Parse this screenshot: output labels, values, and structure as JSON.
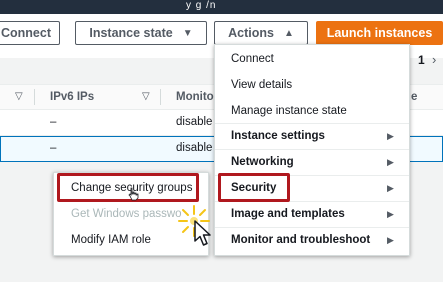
{
  "topbar": {
    "fragment": "y  g /n"
  },
  "toolbar": {
    "connect_label": "Connect",
    "instance_state_label": "Instance state",
    "actions_label": "Actions",
    "launch_label": "Launch instances",
    "caret_down": "▼",
    "caret_up": "▲"
  },
  "pager": {
    "page": "1",
    "next": "›"
  },
  "table": {
    "columns": [
      "IPv6 IPs",
      "Monito",
      "e"
    ],
    "rows": [
      {
        "ipv6": "–",
        "monitoring": "disable"
      },
      {
        "ipv6": "–",
        "monitoring": "disable"
      }
    ]
  },
  "context_menu": {
    "items": [
      {
        "label": "Change security groups",
        "disabled": false
      },
      {
        "label": "Get Windows passwo",
        "disabled": true
      },
      {
        "label": "Modify IAM role",
        "disabled": false
      }
    ]
  },
  "actions_menu": {
    "items": [
      {
        "label": "Connect"
      },
      {
        "label": "View details"
      },
      {
        "label": "Manage instance state"
      },
      {
        "label": "Instance settings"
      },
      {
        "label": "Networking"
      },
      {
        "label": "Security"
      },
      {
        "label": "Image and templates"
      },
      {
        "label": "Monitor and troubleshoot"
      }
    ],
    "submenu_arrow": "▶"
  },
  "colors": {
    "accent": "#ec7211",
    "highlight": "#b0181e",
    "selected_row_border": "#0073bb",
    "topbar": "#232f3e"
  },
  "icons": {
    "filter": "filter-triangle-icon",
    "submenu": "submenu-arrow-icon",
    "pointer": "pointer-cursor-icon",
    "hand": "hand-cursor-icon",
    "click": "click-sparkle-icon"
  }
}
